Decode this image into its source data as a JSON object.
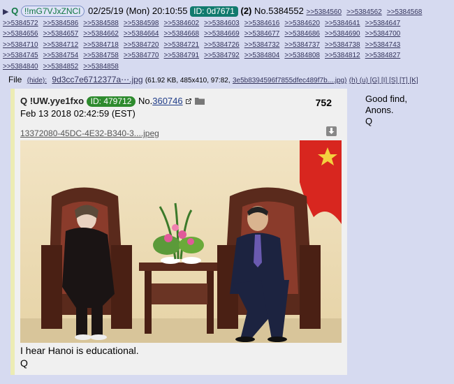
{
  "header": {
    "arrow": "▶",
    "name": "Q",
    "trip": "!!mG7VJxZNCI",
    "datetime": "02/25/19 (Mon) 20:10:55",
    "id_badge": "ID: 0d7671",
    "count": "(2)",
    "post_no": "No.5384552"
  },
  "replies": [
    ">>5384560",
    ">>5384562",
    ">>5384568",
    ">>5384572",
    ">>5384586",
    ">>5384588",
    ">>5384598",
    ">>5384602",
    ">>5384603",
    ">>5384616",
    ">>5384620",
    ">>5384641",
    ">>5384647",
    ">>5384656",
    ">>5384657",
    ">>5384662",
    ">>5384664",
    ">>5384668",
    ">>5384669",
    ">>5384677",
    ">>5384686",
    ">>5384690",
    ">>5384700",
    ">>5384710",
    ">>5384712",
    ">>5384718",
    ">>5384720",
    ">>5384721",
    ">>5384726",
    ">>5384732",
    ">>5384737",
    ">>5384738",
    ">>5384743",
    ">>5384745",
    ">>5384754",
    ">>5384758",
    ">>5384770",
    ">>5384791",
    ">>5384792",
    ">>5384804",
    ">>5384808",
    ">>5384812",
    ">>5384827",
    ">>5384840",
    ">>5384852",
    ">>5384858"
  ],
  "file": {
    "label": "File",
    "hide": "(hide):",
    "name": "9d3cc7e6712377a⋯.jpg",
    "meta": "(61.92 KB, 485x410, 97:82,",
    "hash": "3e5b8394596f7855dfec489f7b....jpg)",
    "links": "(h) (u) [G] [I] [S] [T] [K]"
  },
  "quoted": {
    "name": "Q !UW.yye1fxo",
    "id": "ID: 479712",
    "no_label": "No.",
    "no": "360746",
    "count": "752",
    "date": "Feb 13 2018 02:42:59 (EST)",
    "filename": "13372080-45DC-4E32-B340-3....jpeg",
    "text_line1": "I hear Hanoi is educational.",
    "text_line2": "Q"
  },
  "side": {
    "line1": "Good find,",
    "line2": "Anons.",
    "line3": "Q"
  }
}
